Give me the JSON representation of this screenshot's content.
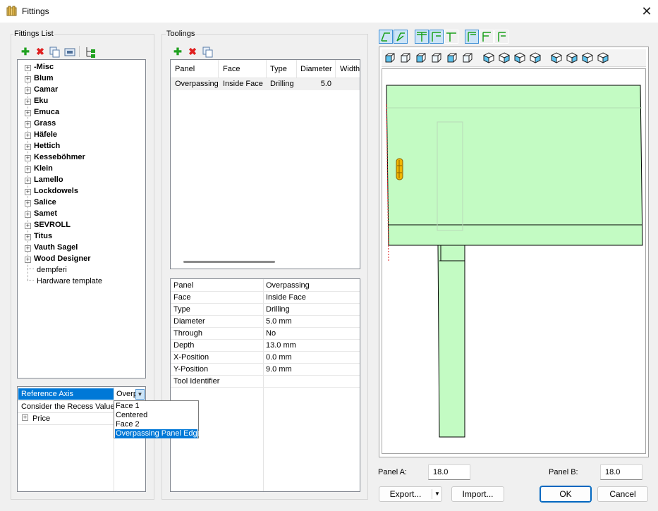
{
  "window": {
    "title": "Fittings",
    "close": "✕"
  },
  "fittings_list": {
    "label": "Fittings List",
    "items": [
      {
        "label": "-Misc",
        "bold": true,
        "expandable": true
      },
      {
        "label": "Blum",
        "bold": true,
        "expandable": true
      },
      {
        "label": "Camar",
        "bold": true,
        "expandable": true
      },
      {
        "label": "Eku",
        "bold": true,
        "expandable": true
      },
      {
        "label": "Emuca",
        "bold": true,
        "expandable": true
      },
      {
        "label": "Grass",
        "bold": true,
        "expandable": true
      },
      {
        "label": "Häfele",
        "bold": true,
        "expandable": true
      },
      {
        "label": "Hettich",
        "bold": true,
        "expandable": true
      },
      {
        "label": "Kesseböhmer",
        "bold": true,
        "expandable": true
      },
      {
        "label": "Klein",
        "bold": true,
        "expandable": true
      },
      {
        "label": "Lamello",
        "bold": true,
        "expandable": true
      },
      {
        "label": "Lockdowels",
        "bold": true,
        "expandable": true
      },
      {
        "label": "Salice",
        "bold": true,
        "expandable": true
      },
      {
        "label": "Samet",
        "bold": true,
        "expandable": true
      },
      {
        "label": "SEVROLL",
        "bold": true,
        "expandable": true
      },
      {
        "label": "Titus",
        "bold": true,
        "expandable": true
      },
      {
        "label": "Vauth Sagel",
        "bold": true,
        "expandable": true
      },
      {
        "label": "Wood Designer",
        "bold": true,
        "expandable": true
      },
      {
        "label": "dempferi",
        "bold": false,
        "expandable": false
      },
      {
        "label": "Hardware template",
        "bold": false,
        "expandable": false
      }
    ]
  },
  "properties": {
    "reference_axis_label": "Reference Axis",
    "reference_axis_value": "Overp",
    "recess_label": "Consider the Recess Value",
    "price_label": "Price",
    "dropdown_options": [
      "Face 1",
      "Centered",
      "Face 2",
      "Overpassing Panel Edge"
    ],
    "selected_option": "Overpassing Panel Edge"
  },
  "toolings": {
    "label": "Toolings",
    "columns": [
      "Panel",
      "Face",
      "Type",
      "Diameter",
      "Width"
    ],
    "rows": [
      {
        "panel": "Overpassing",
        "face": "Inside Face",
        "type": "Drilling",
        "diameter": "5.0",
        "width": ""
      }
    ]
  },
  "details": {
    "rows": [
      {
        "key": "Panel",
        "value": "Overpassing"
      },
      {
        "key": "Face",
        "value": "Inside Face"
      },
      {
        "key": "Type",
        "value": "Drilling"
      },
      {
        "key": "Diameter",
        "value": "5.0 mm"
      },
      {
        "key": "Through",
        "value": "No"
      },
      {
        "key": "Depth",
        "value": "13.0 mm"
      },
      {
        "key": "X-Position",
        "value": "0.0 mm"
      },
      {
        "key": "Y-Position",
        "value": "9.0 mm"
      },
      {
        "key": "Tool Identifier",
        "value": ""
      }
    ]
  },
  "footer": {
    "panel_a_label": "Panel A:",
    "panel_a_value": "18.0",
    "panel_b_label": "Panel B:",
    "panel_b_value": "18.0",
    "export_label": "Export...",
    "import_label": "Import...",
    "ok_label": "OK",
    "cancel_label": "Cancel"
  },
  "colors": {
    "accent": "#0078d7",
    "panel_fill": "#c3fbc3",
    "fitting": "#f0b400"
  }
}
